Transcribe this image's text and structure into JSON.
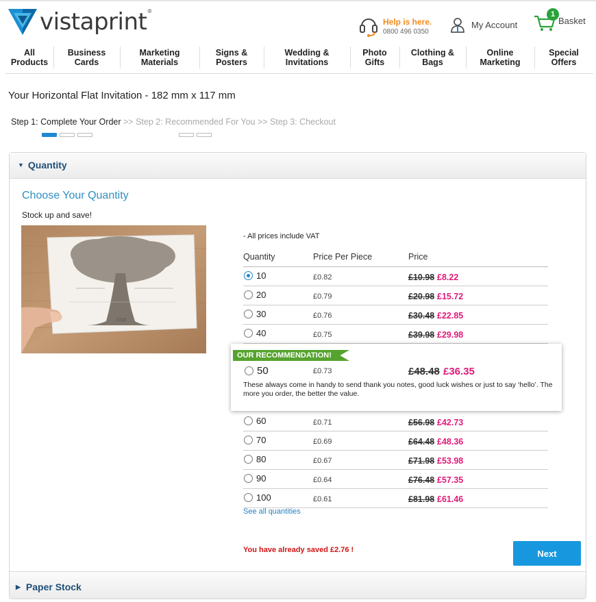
{
  "brand": {
    "name": "vistaprint",
    "trademark": "®"
  },
  "help": {
    "title": "Help is here.",
    "phone": "0800 496 0350"
  },
  "account": {
    "label": "My Account"
  },
  "basket": {
    "label": "Basket",
    "count": "1"
  },
  "nav": [
    {
      "line1": "All",
      "line2": "Products"
    },
    {
      "line1": "Business",
      "line2": "Cards"
    },
    {
      "line1": "Marketing",
      "line2": "Materials"
    },
    {
      "line1": "Signs &",
      "line2": "Posters"
    },
    {
      "line1": "Wedding &",
      "line2": "Invitations"
    },
    {
      "line1": "Photo",
      "line2": "Gifts"
    },
    {
      "line1": "Clothing &",
      "line2": "Bags"
    },
    {
      "line1": "Online",
      "line2": "Marketing"
    },
    {
      "line1": "Special",
      "line2": "Offers"
    }
  ],
  "product_title": "Your Horizontal Flat Invitation - 182 mm x 117 mm",
  "steps": {
    "step1": "Step 1: Complete Your Order",
    "sep": ">>",
    "step2": "Step 2: Recommended For You",
    "step3": "Step 3: Checkout"
  },
  "sections": {
    "quantity": "Quantity",
    "paper_stock": "Paper Stock"
  },
  "choose_title": "Choose Your Quantity",
  "stock_text": "Stock up and save!",
  "vat_note": "- All prices include VAT",
  "table": {
    "headers": {
      "quantity": "Quantity",
      "ppp": "Price Per Piece",
      "price": "Price"
    },
    "rows": [
      {
        "qty": "10",
        "ppp": "£0.82",
        "old": "£10.98",
        "new": "£8.22",
        "selected": true
      },
      {
        "qty": "20",
        "ppp": "£0.79",
        "old": "£20.98",
        "new": "£15.72"
      },
      {
        "qty": "30",
        "ppp": "£0.76",
        "old": "£30.48",
        "new": "£22.85"
      },
      {
        "qty": "40",
        "ppp": "£0.75",
        "old": "£39.98",
        "new": "£29.98"
      },
      {
        "qty": "60",
        "ppp": "£0.71",
        "old": "£56.98",
        "new": "£42.73"
      },
      {
        "qty": "70",
        "ppp": "£0.69",
        "old": "£64.48",
        "new": "£48.36"
      },
      {
        "qty": "80",
        "ppp": "£0.67",
        "old": "£71.98",
        "new": "£53.98"
      },
      {
        "qty": "90",
        "ppp": "£0.64",
        "old": "£76.48",
        "new": "£57.35"
      },
      {
        "qty": "100",
        "ppp": "£0.61",
        "old": "£81.98",
        "new": "£61.46"
      }
    ]
  },
  "recommendation": {
    "tag": "OUR RECOMMENDATION!",
    "qty": "50",
    "ppp": "£0.73",
    "old": "£48.48",
    "new": "£36.35",
    "description": "These always come in handy to send thank you notes, good luck wishes or just to say ‘hello’. The more you order, the better the value."
  },
  "see_all": "See all quantities",
  "saved_msg": "You have already saved £2.76 !",
  "next_label": "Next",
  "card_text": {
    "year": "2016"
  },
  "colors": {
    "brand_blue": "#1e88d4",
    "price_pink": "#e0197a",
    "help_orange": "#f08a1c",
    "rec_green": "#55a32e",
    "next_blue": "#1798de"
  }
}
